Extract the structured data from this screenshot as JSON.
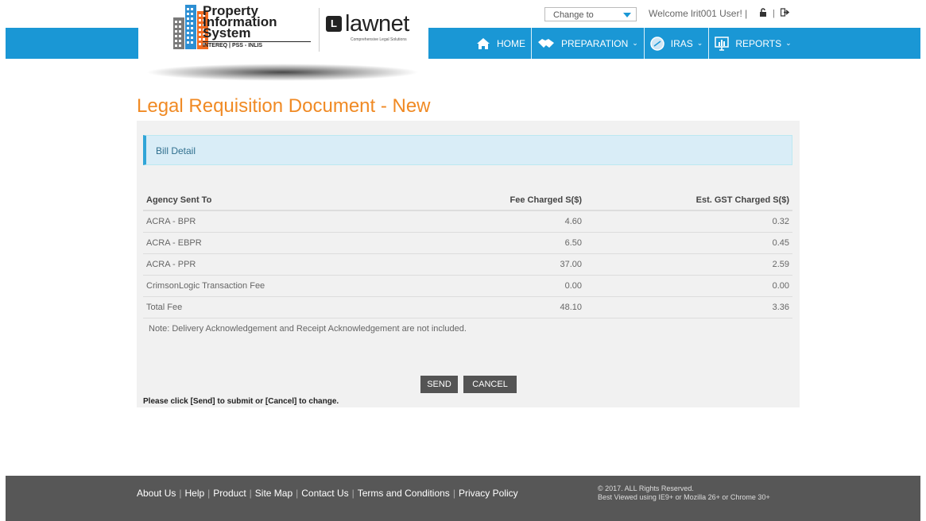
{
  "brand": {
    "pis_line1": "Property",
    "pis_line2": "Information",
    "pis_line3": "System",
    "pis_sub": "INTEREQ | PSS - INLIS",
    "lawnet_name": "lawnet",
    "lawnet_tagline": "Comprehensive Legal Solutions"
  },
  "topbar": {
    "change_to": "Change to",
    "welcome": "Welcome lrit001 User! |",
    "separator": "|"
  },
  "nav": {
    "home": "HOME",
    "preparation": "PREPARATION",
    "iras": "IRAS",
    "reports": "REPORTS",
    "chevron": "⌄"
  },
  "page": {
    "title": "Legal Requisition Document - New"
  },
  "bill": {
    "header": "Bill Detail",
    "columns": [
      "Agency Sent To",
      "Fee Charged S($)",
      "Est. GST Charged S($)"
    ],
    "rows": [
      [
        "ACRA - BPR",
        "4.60",
        "0.32"
      ],
      [
        "ACRA - EBPR",
        "6.50",
        "0.45"
      ],
      [
        "ACRA - PPR",
        "37.00",
        "2.59"
      ],
      [
        "CrimsonLogic Transaction Fee",
        "0.00",
        "0.00"
      ],
      [
        "Total Fee",
        "48.10",
        "3.36"
      ]
    ],
    "note": "Note: Delivery Acknowledgement and Receipt Acknowledgement are not included."
  },
  "actions": {
    "send": "SEND",
    "cancel": "CANCEL",
    "hint": "Please click [Send] to submit or [Cancel] to change."
  },
  "footer": {
    "links": [
      "About Us",
      "Help",
      "Product",
      "Site Map",
      "Contact Us",
      "Terms and Conditions",
      "Privacy Policy"
    ],
    "link_sep": "|",
    "copyright": "© 2017. ALL Rights Reserved.",
    "browsers": "Best Viewed using IE9+ or Mozilla 26+ or Chrome 30+"
  },
  "colors": {
    "nav_blue": "#1a97d5",
    "title_orange": "#f08a24",
    "footer": "#575757"
  }
}
